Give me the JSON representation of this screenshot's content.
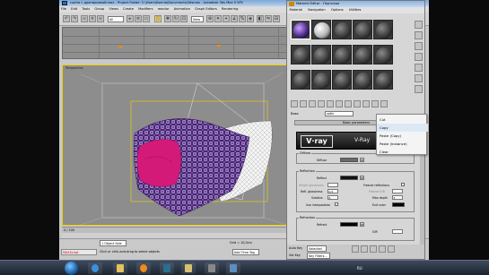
{
  "max_window": {
    "title": "сцена c драпировкой.max  - Project Folder: C:\\Users\\Ksenia\\Documents\\3dsmax  -  Autodesk 3ds Max 9 SP2",
    "menu": [
      "File",
      "Edit",
      "Tools",
      "Group",
      "Views",
      "Create",
      "Modifiers",
      "reactor",
      "Animation",
      "Graph Editors",
      "Rendering"
    ],
    "toolbar": {
      "filter_select": "All",
      "view_select": "View"
    },
    "top_viewport_label": "Top",
    "persp_viewport_label": "Perspective"
  },
  "timeline": {
    "frame": "0 / 100"
  },
  "status": {
    "object_sel": "1 Object Sele",
    "grid": "Grid = 10,0cm",
    "prompt": "Click or click-and-drag to select objects",
    "add_time_tag": "Add Time Tag",
    "maxscript": "MAXScript"
  },
  "material_editor": {
    "title": "Material Editor - Портьера",
    "menu": [
      "Material",
      "Navigation",
      "Options",
      "Utilities"
    ],
    "name_label": "Base",
    "name_value": "satin",
    "rollout": "Basic parameters",
    "vray_logo": "V·ray",
    "vray_text": "V-Ray",
    "diffuse_group": "Diffuse",
    "diffuse_label": "Diffuse",
    "m_label": "M",
    "reflection_group": "Reflection",
    "reflect_label": "Reflect",
    "hilight_gloss": "Hilight glossiness",
    "refl_gloss": "Refl. glossiness",
    "refl_gloss_val": "0,5",
    "subdivs": "Subdivs",
    "subdivs_val": "8",
    "use_interp": "Use interpolation",
    "fresnel": "Fresnel reflections",
    "fresnel_ior": "Fresnel IOR",
    "max_depth": "Max depth",
    "max_depth_val": "5",
    "exit_color": "Exit color",
    "refraction_group": "Refraction",
    "refract_label": "Refract",
    "ior_label": "IOR",
    "bottom_autokey": "Auto Key",
    "bottom_selected": "Selected",
    "bottom_setkey": "Set Key",
    "bottom_keyfilters": "Key Filters..."
  },
  "context_menu": {
    "items": [
      "Cut",
      "Copy",
      "Paste (Copy)",
      "Paste (Instance)",
      "Clear"
    ],
    "hover_index": 1
  },
  "taskbar": {
    "tray_lang": "RU",
    "clock_time": "",
    "clock_date": ""
  },
  "colors": {
    "viewport_border": "#f2d200",
    "fabric_purple": "#5a2a8a",
    "fabric_pink": "#d41a78",
    "start_orb": "#1b5fa8"
  }
}
